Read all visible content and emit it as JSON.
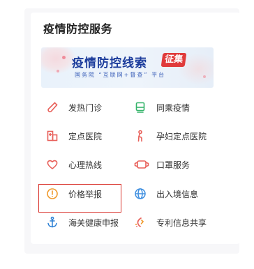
{
  "section": {
    "title": "疫情防控服务"
  },
  "banner": {
    "main_text": "疫情防控线索",
    "badge_text": "征集",
    "sub_text": "国务院 “互联网+督查” 平台"
  },
  "services": [
    {
      "label": "发热门诊",
      "icon": "thermometer-icon",
      "color": "#e8605a"
    },
    {
      "label": "同乘疫情",
      "icon": "train-icon",
      "color": "#35b46a"
    },
    {
      "label": "定点医院",
      "icon": "hospital-icon",
      "color": "#e8605a"
    },
    {
      "label": "孕妇定点医院",
      "icon": "pregnant-woman-icon",
      "color": "#e8605a"
    },
    {
      "label": "心理热线",
      "icon": "heart-icon",
      "color": "#e8605a"
    },
    {
      "label": "口罩服务",
      "icon": "mask-icon",
      "color": "#e8605a"
    },
    {
      "label": "价格举报",
      "icon": "alert-icon",
      "color": "#f09a2c"
    },
    {
      "label": "出入境信息",
      "icon": "globe-icon",
      "color": "#3f8fe0"
    },
    {
      "label": "海关健康申报",
      "icon": "anchor-icon",
      "color": "#2a7fd4"
    },
    {
      "label": "专利信息共享",
      "icon": "patent-icon",
      "color": "#e8605a"
    }
  ],
  "highlight": {
    "color": "#d9332d"
  }
}
